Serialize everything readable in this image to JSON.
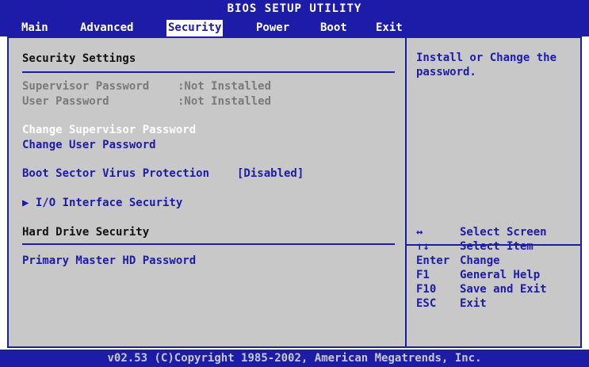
{
  "header": {
    "title": "BIOS SETUP UTILITY",
    "menu": [
      "Main",
      "Advanced",
      "Security",
      "Power",
      "Boot",
      "Exit"
    ],
    "active_menu": "Security"
  },
  "left": {
    "section_title": "Security Settings",
    "supervisor_label": "Supervisor Password",
    "supervisor_value": ":Not Installed",
    "user_label": "User Password",
    "user_value": ":Not Installed",
    "change_supervisor": "Change Supervisor Password",
    "change_user": "Change User Password",
    "boot_sector_label": "Boot Sector Virus Protection",
    "boot_sector_value": "[Disabled]",
    "io_security": "▶ I/O Interface Security",
    "hard_drive_title": "Hard Drive Security",
    "primary_master": "Primary Master HD Password"
  },
  "help": {
    "text_line1": "Install or Change the",
    "text_line2": "password.",
    "keys": [
      {
        "key": "↔",
        "action": "Select Screen"
      },
      {
        "key": "↑↓",
        "action": "Select Item"
      },
      {
        "key": "Enter",
        "action": "Change"
      },
      {
        "key": "F1",
        "action": "General Help"
      },
      {
        "key": "F10",
        "action": "Save and Exit"
      },
      {
        "key": "ESC",
        "action": "Exit"
      }
    ]
  },
  "footer": {
    "copyright": "v02.53 (C)Copyright 1985-2002, American Megatrends, Inc."
  }
}
